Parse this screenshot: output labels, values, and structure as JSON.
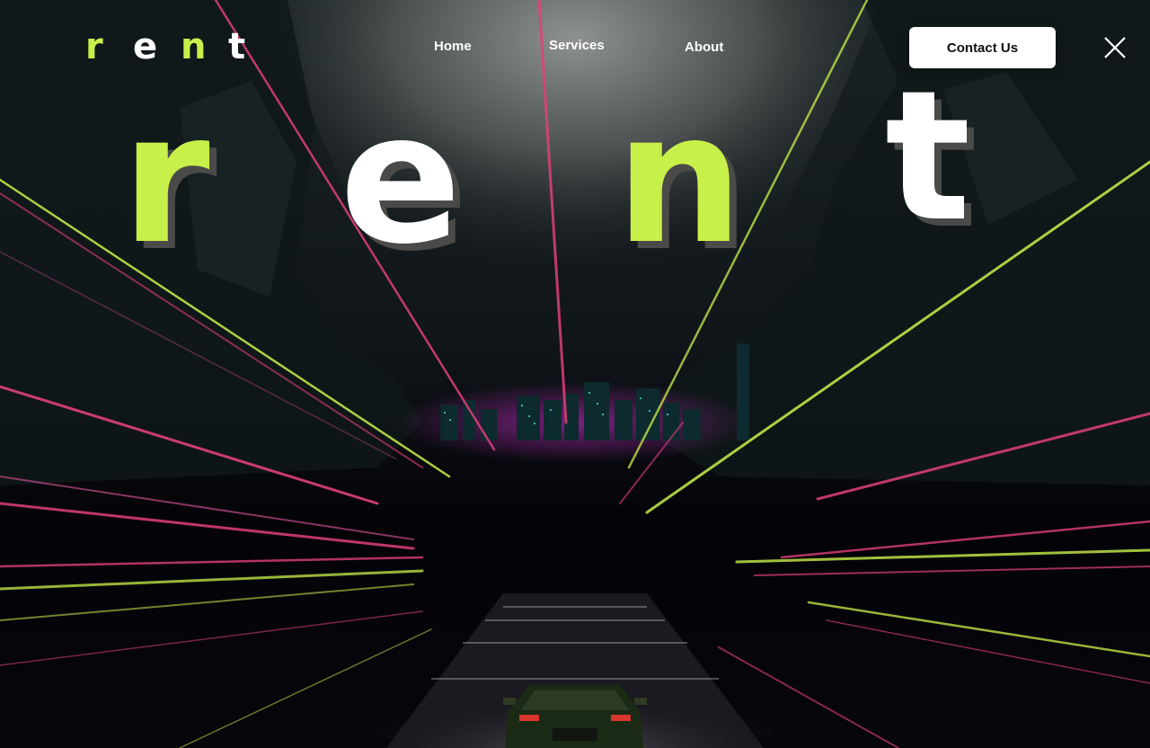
{
  "brand": {
    "logo_letters": [
      "r",
      "e",
      "n",
      "t"
    ],
    "logo_colors": [
      "#c8f04a",
      "#ffffff",
      "#c8f04a",
      "#ffffff"
    ]
  },
  "nav": {
    "items": [
      {
        "label": "Home"
      },
      {
        "label": "Services"
      },
      {
        "label": "About"
      }
    ],
    "contact_label": "Contact Us"
  },
  "hero": {
    "letters": [
      "r",
      "e",
      "n",
      "t"
    ],
    "letter_colors": [
      "#c8f04a",
      "#ffffff",
      "#c8f04a",
      "#ffffff"
    ]
  },
  "theme": {
    "accent_lime": "#c8f04a",
    "accent_pink": "#e0407a",
    "background": "#05040a"
  },
  "icons": {
    "close": "close-icon"
  }
}
